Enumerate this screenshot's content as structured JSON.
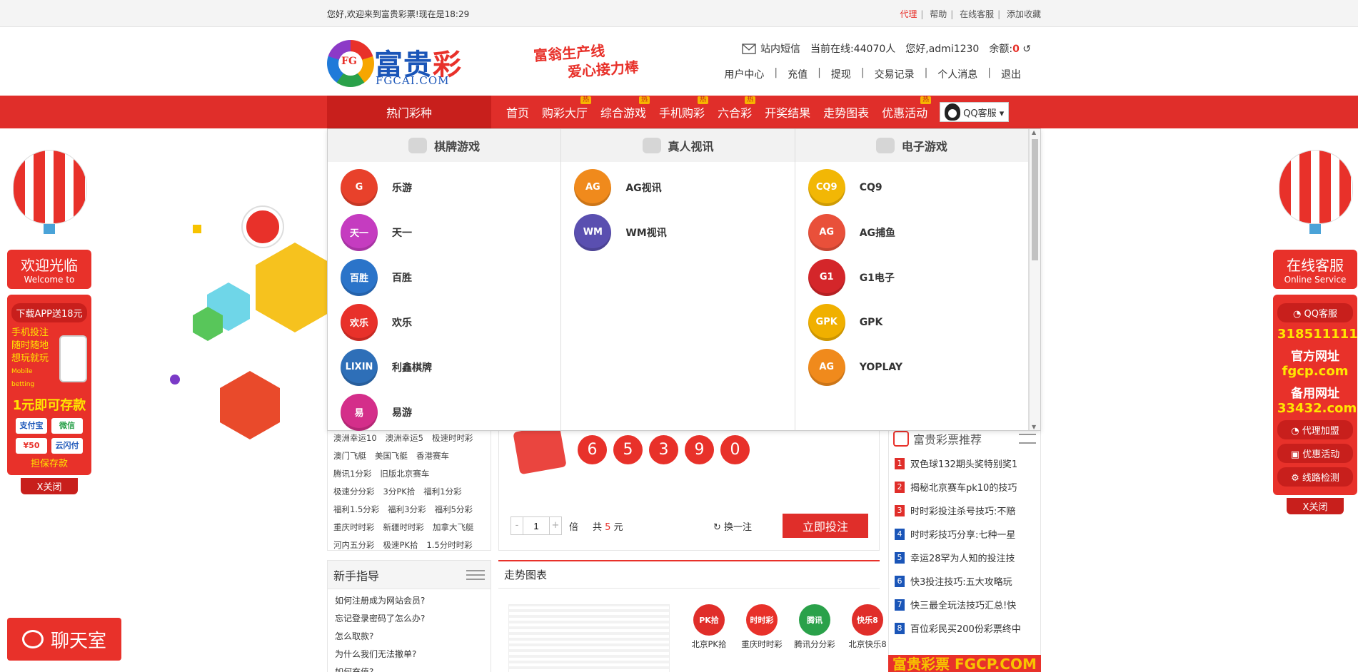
{
  "topbar": {
    "welcome": "您好,欢迎来到富贵彩票!现在是18:29",
    "links": [
      "代理",
      "帮助",
      "在线客服",
      "添加收藏"
    ]
  },
  "logo": {
    "name_a": "富贵",
    "name_b": "彩",
    "sub": "FGCAI.COM",
    "ring": "FG"
  },
  "slogan": {
    "line1": "富翁生产线",
    "line2": "爱心接力棒"
  },
  "userinfo": {
    "mail_label": "站内短信",
    "online_label": "当前在线:",
    "online_count": "44070人",
    "greeting": "您好,admi1230",
    "balance_label": "余额:",
    "balance_value": "0",
    "refresh": "↺"
  },
  "usermenu": [
    "用户中心",
    "充值",
    "提现",
    "交易记录",
    "个人消息",
    "退出"
  ],
  "nav": {
    "hot": "热门彩种",
    "items": [
      {
        "label": "首页",
        "badge": ""
      },
      {
        "label": "购彩大厅",
        "badge": "热"
      },
      {
        "label": "综合游戏",
        "badge": "热"
      },
      {
        "label": "手机购彩",
        "badge": "热"
      },
      {
        "label": "六合彩",
        "badge": "热"
      },
      {
        "label": "开奖结果",
        "badge": ""
      },
      {
        "label": "走势图表",
        "badge": ""
      },
      {
        "label": "优惠活动",
        "badge": "热"
      }
    ],
    "qq": "QQ客服 ▾"
  },
  "dropdown": {
    "columns": [
      {
        "title": "棋牌游戏",
        "items": [
          {
            "label": "乐游",
            "icon_text": "G",
            "color": "#e8412b"
          },
          {
            "label": "天一",
            "icon_text": "天一",
            "color": "#c53cc0"
          },
          {
            "label": "百胜",
            "icon_text": "百胜",
            "color": "#2b74c9"
          },
          {
            "label": "欢乐",
            "icon_text": "欢乐",
            "color": "#e8312a"
          },
          {
            "label": "利鑫棋牌",
            "icon_text": "LIXIN",
            "color": "#2e6fb8"
          },
          {
            "label": "易游",
            "icon_text": "易",
            "color": "#d42e8a"
          }
        ]
      },
      {
        "title": "真人视讯",
        "items": [
          {
            "label": "AG视讯",
            "icon_text": "AG",
            "color": "#f08a1c"
          },
          {
            "label": "WM视讯",
            "icon_text": "WM",
            "color": "#5a4fb0"
          }
        ]
      },
      {
        "title": "电子游戏",
        "items": [
          {
            "label": "CQ9",
            "icon_text": "CQ9",
            "color": "#f2b705"
          },
          {
            "label": "AG捕鱼",
            "icon_text": "AG",
            "color": "#e9503a"
          },
          {
            "label": "G1电子",
            "icon_text": "G1",
            "color": "#d4262a"
          },
          {
            "label": "GPK",
            "icon_text": "GPK",
            "color": "#f0b000"
          },
          {
            "label": "YOPLAY",
            "icon_text": "AG",
            "color": "#f08a1c"
          }
        ]
      }
    ]
  },
  "leftlist": {
    "rows": [
      [
        "澳洲幸运10",
        "澳洲幸运5",
        "极速时时彩"
      ],
      [
        "澳门飞艇",
        "美国飞艇",
        "香港赛车"
      ],
      [
        "腾讯1分彩",
        "旧版北京赛车"
      ],
      [
        "极速分分彩",
        "3分PK拾",
        "福利1分彩"
      ],
      [
        "福利1.5分彩",
        "福利3分彩",
        "福利5分彩"
      ],
      [
        "重庆时时彩",
        "新疆时时彩",
        "加拿大飞艇"
      ],
      [
        "河内五分彩",
        "极速PK拾",
        "1.5分时时彩"
      ]
    ]
  },
  "guide": {
    "title": "新手指导",
    "questions": [
      "如何注册成为网站会员?",
      "忘记登录密码了怎么办?",
      "怎么取款?",
      "为什么我们无法撤单?",
      "如何充值?"
    ]
  },
  "draw": {
    "balls": [
      "6",
      "5",
      "3",
      "9",
      "0"
    ],
    "multiplier": "1",
    "times_label": "倍",
    "total_label": "共",
    "total_value": "5",
    "unit": "元",
    "change": "换一注",
    "bet_button": "立即投注"
  },
  "trend": {
    "title": "走势图表",
    "lotteries": [
      {
        "label": "北京PK拾",
        "icon_text": "PK拾",
        "color": "#e02e2a"
      },
      {
        "label": "重庆时时彩",
        "icon_text": "时时彩",
        "color": "#e8312a"
      },
      {
        "label": "腾讯分分彩",
        "icon_text": "腾讯",
        "color": "#2aa14a"
      },
      {
        "label": "北京快乐8",
        "icon_text": "快乐8",
        "color": "#e02e2a"
      }
    ]
  },
  "recommend": {
    "title": "富贵彩票推荐",
    "items": [
      {
        "num": "1",
        "text": "双色球132期头奖特别奖1",
        "color": "#e02e2a"
      },
      {
        "num": "2",
        "text": "揭秘北京赛车pk10的技巧",
        "color": "#e02e2a"
      },
      {
        "num": "3",
        "text": "时时彩投注杀号技巧:不赔",
        "color": "#e02e2a"
      },
      {
        "num": "4",
        "text": "时时彩技巧分享:七种一星",
        "color": "#1a55b8"
      },
      {
        "num": "5",
        "text": "幸运28罕为人知的投注技",
        "color": "#1a55b8"
      },
      {
        "num": "6",
        "text": "快3投注技巧:五大攻略玩",
        "color": "#1a55b8"
      },
      {
        "num": "7",
        "text": "快三最全玩法技巧汇总!快",
        "color": "#1a55b8"
      },
      {
        "num": "8",
        "text": "百位彩民买200份彩票终中",
        "color": "#1a55b8"
      }
    ]
  },
  "banner": "富贵彩票 FGCP.COM",
  "side_left": {
    "big": "欢迎光临",
    "small": "Welcome to",
    "app": "下载APP送18元",
    "phone_lines": [
      "手机投注",
      "随时随地",
      "想玩就玩"
    ],
    "mobile": "Mobile betting",
    "deposit": "1元即可存款",
    "pay1": "支付宝",
    "pay2": "微信",
    "pay3": "¥50",
    "pay4": "云闪付",
    "guarantee": "担保存款",
    "close": "X关闭"
  },
  "side_right": {
    "big": "在线客服",
    "small": "Online Service",
    "qq": "QQ客服",
    "qq_num": "318511111",
    "official_label": "官方网址",
    "official": "fgcp.com",
    "backup_label": "备用网址",
    "backup": "33432.com",
    "agent": "代理加盟",
    "promo": "优惠活动",
    "check": "线路检测",
    "close": "X关闭"
  },
  "chatroom": "聊天室"
}
